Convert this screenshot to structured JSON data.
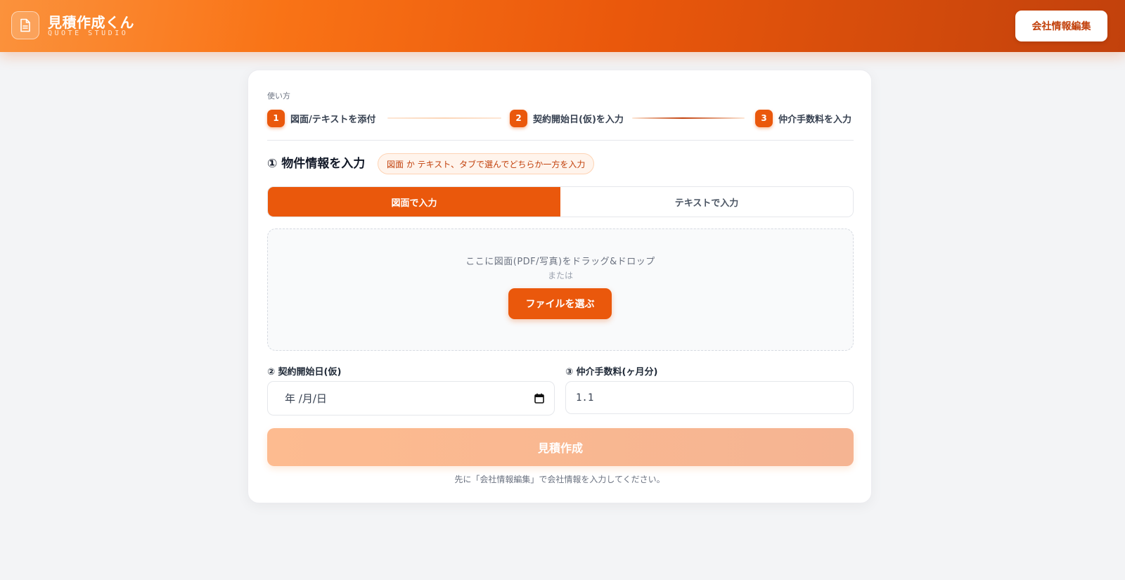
{
  "header": {
    "title": "見積作成くん",
    "subtitle": "QUOTE STUDIO",
    "company_button": "会社情報編集",
    "logo_icon": "document-icon"
  },
  "steps": {
    "label": "使い方",
    "items": [
      {
        "num": "1",
        "label": "図面/テキストを添付"
      },
      {
        "num": "2",
        "label": "契約開始日(仮)を入力"
      },
      {
        "num": "3",
        "label": "仲介手数料を入力"
      }
    ]
  },
  "section": {
    "title": "① 物件情報を入力",
    "hint": "図面 か テキスト、タブで選んでどちらか一方を入力"
  },
  "tabs": [
    {
      "label": "図面で入力",
      "active": true
    },
    {
      "label": "テキストで入力",
      "active": false
    }
  ],
  "dropzone": {
    "text": "ここに図面(PDF/写真)をドラッグ&ドロップ",
    "or": "または",
    "button": "ファイルを選ぶ"
  },
  "fields": {
    "date_label": "② 契約開始日(仮)",
    "date_placeholder": "年 /月/日",
    "fee_label": "③ 仲介手数料(ヶ月分)",
    "fee_value": "1.1"
  },
  "submit": {
    "label": "見積作成",
    "notice": "先に「会社情報編集」で会社情報を入力してください。"
  },
  "colors": {
    "accent": "#ea580c",
    "accent_dark": "#c2410c",
    "background": "#f3f4f6"
  }
}
